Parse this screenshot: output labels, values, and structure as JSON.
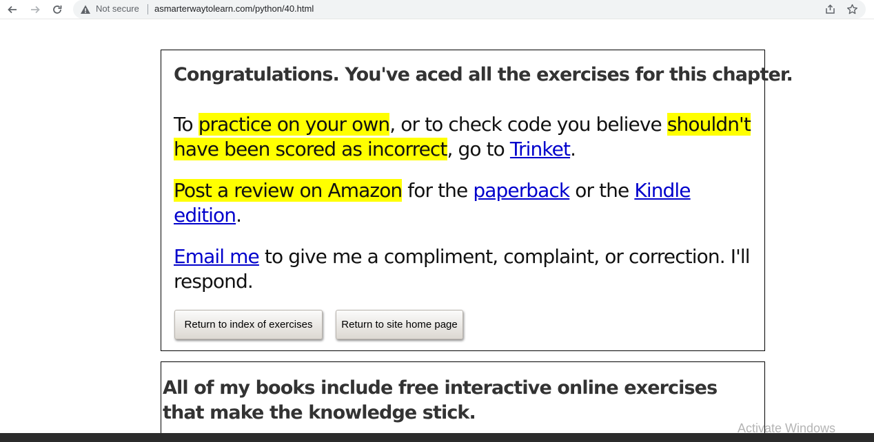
{
  "browser": {
    "security_label": "Not secure",
    "url": "asmarterwaytolearn.com/python/40.html",
    "icons": [
      "back-arrow-icon",
      "forward-arrow-icon",
      "reload-icon",
      "warning-icon",
      "share-icon",
      "star-icon"
    ]
  },
  "main": {
    "heading": "Congratulations. You've aced all the exercises for this chapter.",
    "p1": {
      "t1": "To ",
      "hl1": "practice on your own",
      "t2": ", or to check code you believe ",
      "hl2a": "shouldn't",
      "hl2b": "have been scored as incorrect",
      "t3": ", go to ",
      "link": "Trinket",
      "t4": "."
    },
    "p2": {
      "hl": "Post a review on Amazon",
      "t1": " for the ",
      "link1": "paperback",
      "t2": " or the ",
      "link2": "Kindle edition",
      "t3": "."
    },
    "p3": {
      "link": "Email me",
      "t1": " to give me a compliment, complaint, or correction. I'll respond."
    },
    "buttons": {
      "index": "Return to index of exercises",
      "home": "Return to site home page"
    }
  },
  "books": {
    "heading": "All of my books include free interactive online exercises that make the knowledge stick."
  },
  "os": {
    "watermark": "Activate Windows"
  },
  "colors": {
    "highlight": "#ffff00",
    "link": "#0000cc",
    "heading": "#333333"
  }
}
